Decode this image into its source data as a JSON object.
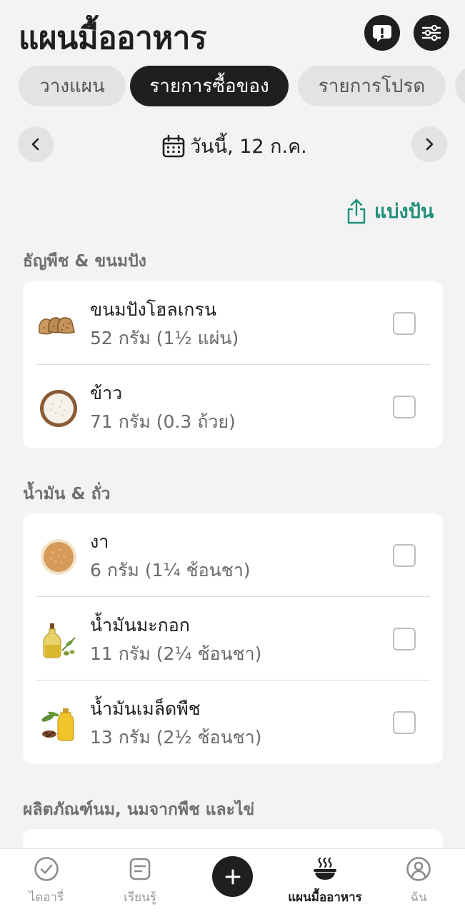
{
  "header": {
    "title": "แผนมื้ออาหาร"
  },
  "tabs": [
    {
      "label": "วางแผน"
    },
    {
      "label": "รายการซื้อของ"
    },
    {
      "label": "รายการโปรด"
    }
  ],
  "date_bar": {
    "date_label": "วันนี้, 12 ก.ค."
  },
  "share": {
    "label": "แบ่งปัน"
  },
  "sections": [
    {
      "title": "ธัญพืช & ขนมปัง",
      "items": [
        {
          "name": "ขนมปังโฮลเกรน",
          "quantity": "52 กรัม (1½ แผ่น)",
          "icon": "bread-icon"
        },
        {
          "name": "ข้าว",
          "quantity": "71 กรัม (0.3 ถ้วย)",
          "icon": "rice-bowl-icon"
        }
      ]
    },
    {
      "title": "น้ำมัน & ถั่ว",
      "items": [
        {
          "name": "งา",
          "quantity": "6 กรัม (1¼ ช้อนชา)",
          "icon": "sesame-bowl-icon"
        },
        {
          "name": "น้ำมันมะกอก",
          "quantity": "11 กรัม (2¼ ช้อนชา)",
          "icon": "olive-oil-icon"
        },
        {
          "name": "น้ำมันเมล็ดพืช",
          "quantity": "13 กรัม (2½ ช้อนชา)",
          "icon": "seed-oil-icon"
        }
      ]
    },
    {
      "title": "ผลิตภัณฑ์นม, นมจากพืช และไข่"
    }
  ],
  "bottom_nav": [
    {
      "label": "ไดอารี่",
      "icon": "check-circle-icon"
    },
    {
      "label": "เรียนรู้",
      "icon": "note-icon"
    },
    {
      "label": "",
      "icon": "plus-icon"
    },
    {
      "label": "แผนมื้ออาหาร",
      "icon": "hot-bowl-icon"
    },
    {
      "label": "ฉัน",
      "icon": "profile-icon"
    }
  ],
  "colors": {
    "accent": "#1f8f7a",
    "dark": "#1f1f1f",
    "background": "#f3f3f3"
  }
}
